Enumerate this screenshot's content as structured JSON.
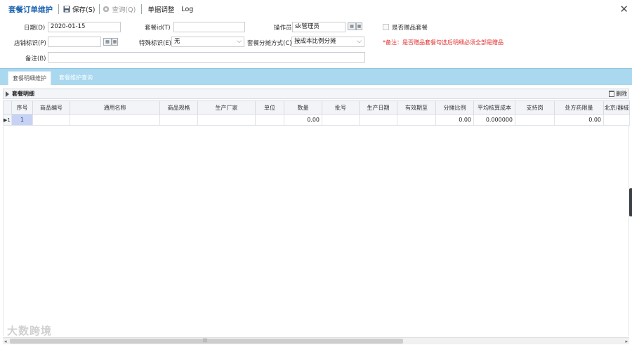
{
  "toolbar": {
    "title": "套餐订单维护",
    "save": "保存(S)",
    "query": "查询(Q)",
    "adjust": "单据调整",
    "log": "Log"
  },
  "form": {
    "date_label": "日期(D)",
    "date_value": "2020-01-15",
    "package_id_label": "套餐id(T)",
    "package_id_value": "",
    "operator_label": "操作员",
    "operator_value": "sk管理员",
    "gift_label": "是否赠品套餐",
    "store_label": "店铺标识(P)",
    "store_value": "",
    "special_label": "特殊标识(E)",
    "special_value": "无",
    "split_label": "套餐分摊方式(C)",
    "split_value": "按成本比例分摊",
    "warning": "*备注：是否赠品套餐勾选后明细必须全部是赠品",
    "note_label": "备注(B)",
    "note_value": ""
  },
  "tabs": [
    {
      "label": "套餐明细维护",
      "active": true
    },
    {
      "label": "套餐维护查询",
      "active": false
    }
  ],
  "grid": {
    "title": "套餐明细",
    "delete": "删除",
    "columns": [
      "序号",
      "商品编号",
      "通用名称",
      "商品规格",
      "生产厂家",
      "单位",
      "数量",
      "批号",
      "生产日期",
      "有效期至",
      "分摊比例",
      "平均核算成本",
      "支持岗",
      "处方药限量",
      "北京/器械"
    ],
    "rows": [
      {
        "mark": "▶1",
        "seq": "1",
        "qty": "0.00",
        "ratio": "0.00",
        "cost": "0.000000",
        "limit": "0.00"
      }
    ]
  },
  "watermark": "大数跨境"
}
